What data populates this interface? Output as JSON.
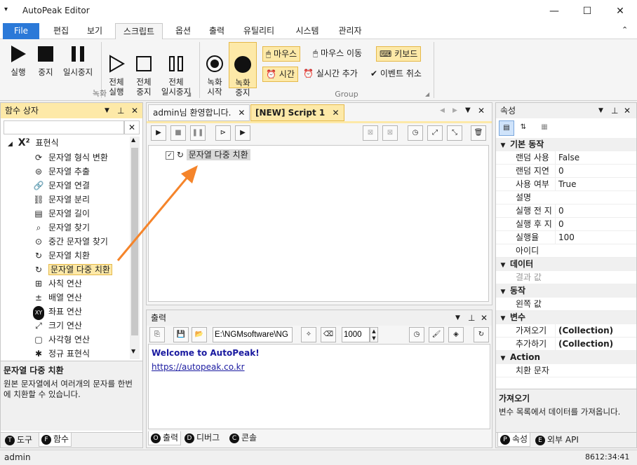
{
  "window": {
    "title": "AutoPeak Editor",
    "minimize": "—",
    "maximize": "☐",
    "close": "✕",
    "menu_glyph": "▾"
  },
  "menu": {
    "tabs": [
      "File",
      "편집",
      "보기",
      "스크립트",
      "옵션",
      "출력",
      "유틸리티",
      "시스템",
      "관리자"
    ],
    "active": "스크립트",
    "collapse_glyph": "⌃"
  },
  "ribbon": {
    "buttons": [
      {
        "label": "실행",
        "icon": "play-icon"
      },
      {
        "label": "중지",
        "icon": "stop-icon"
      },
      {
        "label": "일시중지",
        "icon": "pause-icon"
      },
      {
        "label": "전체\n실행",
        "icon": "play-outline-icon"
      },
      {
        "label": "전체\n중지",
        "icon": "stop-outline-icon"
      },
      {
        "label": "전체\n일시중지",
        "icon": "pause-outline-icon"
      },
      {
        "label": "녹화\n시작",
        "icon": "record-icon"
      },
      {
        "label": "녹화\n중지",
        "icon": "record-stop-icon"
      }
    ],
    "group1": "녹화",
    "group2": "Group",
    "small": {
      "mouse": "마우스",
      "mouse_move": "마우스 이동",
      "keyboard": "키보드",
      "time": "시간",
      "realtime": "실시간 추가",
      "event_cancel": "이벤트 취소"
    }
  },
  "left": {
    "title": "함수 상자",
    "search_placeholder": "",
    "search_clear": "✕",
    "category": "표현식",
    "items": [
      {
        "label": "문자열 형식 변환",
        "icon": "format-icon"
      },
      {
        "label": "문자열 추출",
        "icon": "extract-icon"
      },
      {
        "label": "문자열 연결",
        "icon": "link-icon"
      },
      {
        "label": "문자열 분리",
        "icon": "unlink-icon"
      },
      {
        "label": "문자열 길이",
        "icon": "length-icon"
      },
      {
        "label": "문자열 찾기",
        "icon": "search-icon"
      },
      {
        "label": "중간 문자열 찾기",
        "icon": "search-mid-icon"
      },
      {
        "label": "문자열 치환",
        "icon": "replace-icon"
      },
      {
        "label": "문자열 다중 치환",
        "icon": "multi-replace-icon"
      },
      {
        "label": "사칙 연산",
        "icon": "calc-icon"
      },
      {
        "label": "배열 연산",
        "icon": "plusminus-icon"
      },
      {
        "label": "좌표 연산",
        "icon": "xy-icon"
      },
      {
        "label": "크기 연산",
        "icon": "resize-icon"
      },
      {
        "label": "사각형 연산",
        "icon": "rect-icon"
      },
      {
        "label": "정규 표현식",
        "icon": "asterisk-icon"
      }
    ],
    "selected": "문자열 다중 치환",
    "desc_title": "문자열 다중 치환",
    "desc": "원본 문자열에서 여러개의 문자를 한번에 치환할 수 있습니다.",
    "tabs": [
      {
        "letter": "T",
        "label": "도구"
      },
      {
        "letter": "F",
        "label": "함수"
      }
    ]
  },
  "editor": {
    "tabs": [
      "admin님 환영합니다.",
      "[NEW] Script 1"
    ],
    "active": "[NEW] Script 1",
    "node_label": "문자열 다중 치환"
  },
  "output": {
    "title": "출력",
    "path": "E:\\NGMsoftware\\NG",
    "count": "1000",
    "lines": [
      "Welcome to AutoPeak!",
      "https://autopeak.co.kr"
    ],
    "tabs": [
      {
        "letter": "O",
        "label": "출력"
      },
      {
        "letter": "D",
        "label": "디버그"
      },
      {
        "letter": "C",
        "label": "콘솔"
      }
    ]
  },
  "props": {
    "title": "속성",
    "categories": [
      {
        "name": "기본 동작",
        "rows": [
          [
            "랜덤 사용",
            "False"
          ],
          [
            "랜덤 지연",
            "0"
          ],
          [
            "사용 여부",
            "True"
          ],
          [
            "설명",
            ""
          ],
          [
            "실행 전 지",
            "0"
          ],
          [
            "실행 후 지",
            "0"
          ],
          [
            "실행율",
            "100"
          ],
          [
            "아이디",
            ""
          ]
        ]
      },
      {
        "name": "데이터",
        "rows": [
          [
            "결과 값",
            ""
          ]
        ]
      },
      {
        "name": "동작",
        "rows": [
          [
            "왼쪽 값",
            ""
          ]
        ]
      },
      {
        "name": "변수",
        "rows": [
          [
            "가져오기",
            "(Collection)"
          ],
          [
            "추가하기",
            "(Collection)"
          ]
        ]
      },
      {
        "name": "Action",
        "rows": [
          [
            "치환 문자",
            ""
          ]
        ]
      }
    ],
    "desc_title": "가져오기",
    "desc": "변수 목록에서 데이터를 가져옵니다.",
    "tabs": [
      {
        "letter": "P",
        "label": "속성"
      },
      {
        "letter": "E",
        "label": "외부 API"
      }
    ]
  },
  "status": {
    "user": "admin",
    "time": "8612:34:41"
  },
  "colors": {
    "accent": "#2b79d8",
    "highlight": "#fde9a8",
    "arrow": "#f5842a"
  }
}
